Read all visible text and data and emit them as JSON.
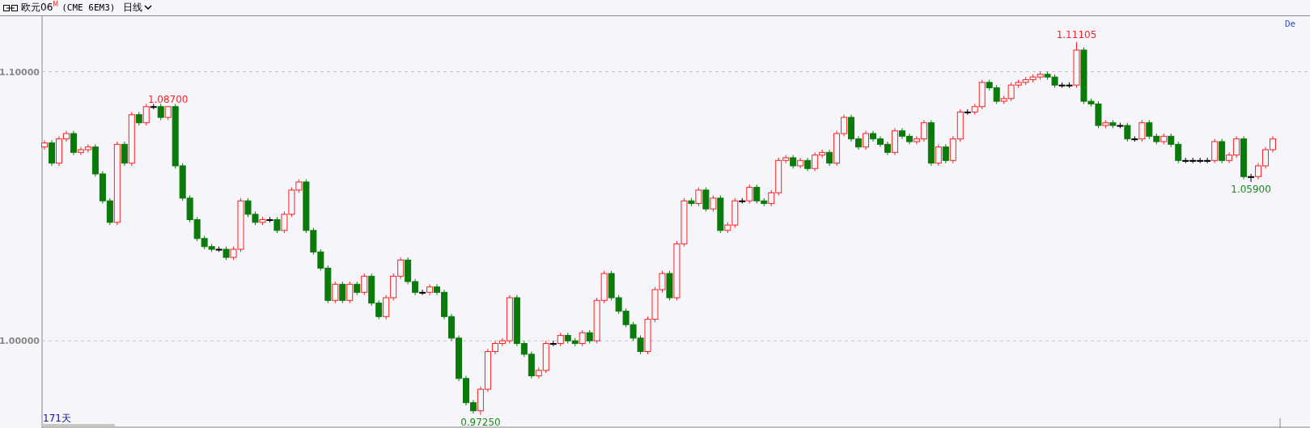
{
  "header": {
    "title": "欧元06$^{M}$",
    "contract": "(CME 6EM3)",
    "period": "日线"
  },
  "chart": {
    "corner_text": "De",
    "day_count": "171天",
    "chart_data": {
      "type": "candlestick",
      "ylim": [
        0.9676,
        1.1206
      ],
      "yticks": [
        {
          "value": 1.1,
          "label": "1.10000"
        },
        {
          "value": 1.0,
          "label": "1.00000"
        }
      ],
      "ohlc": [
        [
          1.072,
          1.0745,
          1.071,
          1.0735
        ],
        [
          1.0735,
          1.0745,
          1.065,
          1.066
        ],
        [
          1.066,
          1.076,
          1.065,
          1.075
        ],
        [
          1.075,
          1.078,
          1.074,
          1.077
        ],
        [
          1.077,
          1.078,
          1.069,
          1.07
        ],
        [
          1.07,
          1.072,
          1.069,
          1.071
        ],
        [
          1.071,
          1.073,
          1.07,
          1.072
        ],
        [
          1.072,
          1.073,
          1.061,
          1.062
        ],
        [
          1.062,
          1.063,
          1.051,
          1.052
        ],
        [
          1.052,
          1.053,
          1.043,
          1.044
        ],
        [
          1.044,
          1.074,
          1.043,
          1.073
        ],
        [
          1.073,
          1.074,
          1.065,
          1.066
        ],
        [
          1.066,
          1.085,
          1.065,
          1.084
        ],
        [
          1.084,
          1.085,
          1.08,
          1.081
        ],
        [
          1.081,
          1.088,
          1.08,
          1.087
        ],
        [
          1.087,
          1.088,
          1.086,
          1.087
        ],
        [
          1.087,
          1.088,
          1.082,
          1.083
        ],
        [
          1.083,
          1.087,
          1.082,
          1.087
        ],
        [
          1.087,
          1.088,
          1.064,
          1.065
        ],
        [
          1.065,
          1.066,
          1.052,
          1.053
        ],
        [
          1.053,
          1.054,
          1.044,
          1.045
        ],
        [
          1.045,
          1.046,
          1.037,
          1.038
        ],
        [
          1.038,
          1.039,
          1.034,
          1.035
        ],
        [
          1.035,
          1.036,
          1.033,
          1.034
        ],
        [
          1.034,
          1.035,
          1.033,
          1.034
        ],
        [
          1.034,
          1.035,
          1.03,
          1.031
        ],
        [
          1.031,
          1.035,
          1.03,
          1.034
        ],
        [
          1.034,
          1.053,
          1.033,
          1.052
        ],
        [
          1.052,
          1.053,
          1.046,
          1.047
        ],
        [
          1.047,
          1.048,
          1.043,
          1.044
        ],
        [
          1.044,
          1.046,
          1.043,
          1.045
        ],
        [
          1.045,
          1.046,
          1.044,
          1.045
        ],
        [
          1.045,
          1.046,
          1.04,
          1.041
        ],
        [
          1.041,
          1.048,
          1.04,
          1.047
        ],
        [
          1.047,
          1.057,
          1.046,
          1.056
        ],
        [
          1.056,
          1.06,
          1.055,
          1.059
        ],
        [
          1.059,
          1.06,
          1.04,
          1.041
        ],
        [
          1.041,
          1.042,
          1.032,
          1.033
        ],
        [
          1.033,
          1.034,
          1.026,
          1.027
        ],
        [
          1.027,
          1.028,
          1.014,
          1.015
        ],
        [
          1.015,
          1.022,
          1.014,
          1.021
        ],
        [
          1.021,
          1.022,
          1.014,
          1.015
        ],
        [
          1.015,
          1.022,
          1.014,
          1.021
        ],
        [
          1.021,
          1.022,
          1.017,
          1.018
        ],
        [
          1.018,
          1.025,
          1.017,
          1.024
        ],
        [
          1.024,
          1.025,
          1.013,
          1.014
        ],
        [
          1.014,
          1.015,
          1.008,
          1.009
        ],
        [
          1.009,
          1.017,
          1.008,
          1.016
        ],
        [
          1.016,
          1.025,
          1.015,
          1.024
        ],
        [
          1.024,
          1.031,
          1.023,
          1.03
        ],
        [
          1.03,
          1.031,
          1.021,
          1.022
        ],
        [
          1.022,
          1.023,
          1.017,
          1.018
        ],
        [
          1.018,
          1.019,
          1.017,
          1.018
        ],
        [
          1.018,
          1.021,
          1.017,
          1.02
        ],
        [
          1.02,
          1.021,
          1.017,
          1.018
        ],
        [
          1.018,
          1.019,
          1.008,
          1.009
        ],
        [
          1.009,
          1.01,
          1.0,
          1.001
        ],
        [
          1.001,
          1.002,
          0.985,
          0.986
        ],
        [
          0.986,
          0.987,
          0.976,
          0.977
        ],
        [
          0.977,
          0.978,
          0.973,
          0.974
        ],
        [
          0.974,
          0.983,
          0.9725,
          0.982
        ],
        [
          0.982,
          0.997,
          0.981,
          0.996
        ],
        [
          0.996,
          1.0,
          0.995,
          0.999
        ],
        [
          0.999,
          1.001,
          0.998,
          1.0
        ],
        [
          1.0,
          1.017,
          0.999,
          1.016
        ],
        [
          1.016,
          1.017,
          0.998,
          0.999
        ],
        [
          0.999,
          1.0,
          0.994,
          0.995
        ],
        [
          0.995,
          0.996,
          0.986,
          0.987
        ],
        [
          0.987,
          0.99,
          0.986,
          0.989
        ],
        [
          0.989,
          1.0,
          0.988,
          0.999
        ],
        [
          0.999,
          1.0,
          0.998,
          0.999
        ],
        [
          0.999,
          1.003,
          0.998,
          1.002
        ],
        [
          1.002,
          1.003,
          0.999,
          1.0
        ],
        [
          1.0,
          1.001,
          0.998,
          0.999
        ],
        [
          0.999,
          1.004,
          0.998,
          1.003
        ],
        [
          1.003,
          1.004,
          0.999,
          1.0
        ],
        [
          1.0,
          1.016,
          0.999,
          1.015
        ],
        [
          1.015,
          1.026,
          1.014,
          1.025
        ],
        [
          1.025,
          1.026,
          1.015,
          1.016
        ],
        [
          1.016,
          1.017,
          1.01,
          1.011
        ],
        [
          1.011,
          1.012,
          1.005,
          1.006
        ],
        [
          1.006,
          1.007,
          1.0,
          1.001
        ],
        [
          1.001,
          1.002,
          0.995,
          0.996
        ],
        [
          0.996,
          1.009,
          0.995,
          1.008
        ],
        [
          1.008,
          1.02,
          1.007,
          1.019
        ],
        [
          1.019,
          1.026,
          1.018,
          1.025
        ],
        [
          1.025,
          1.026,
          1.015,
          1.016
        ],
        [
          1.016,
          1.037,
          1.015,
          1.036
        ],
        [
          1.036,
          1.053,
          1.035,
          1.052
        ],
        [
          1.052,
          1.053,
          1.05,
          1.051
        ],
        [
          1.051,
          1.057,
          1.05,
          1.056
        ],
        [
          1.056,
          1.057,
          1.048,
          1.049
        ],
        [
          1.049,
          1.054,
          1.048,
          1.053
        ],
        [
          1.053,
          1.054,
          1.04,
          1.041
        ],
        [
          1.041,
          1.044,
          1.04,
          1.043
        ],
        [
          1.043,
          1.053,
          1.042,
          1.052
        ],
        [
          1.052,
          1.053,
          1.051,
          1.052
        ],
        [
          1.052,
          1.058,
          1.051,
          1.057
        ],
        [
          1.057,
          1.058,
          1.051,
          1.052
        ],
        [
          1.052,
          1.053,
          1.05,
          1.051
        ],
        [
          1.051,
          1.056,
          1.05,
          1.055
        ],
        [
          1.055,
          1.068,
          1.054,
          1.067
        ],
        [
          1.067,
          1.069,
          1.066,
          1.068
        ],
        [
          1.068,
          1.069,
          1.064,
          1.065
        ],
        [
          1.065,
          1.068,
          1.064,
          1.067
        ],
        [
          1.067,
          1.068,
          1.063,
          1.064
        ],
        [
          1.064,
          1.07,
          1.063,
          1.069
        ],
        [
          1.069,
          1.071,
          1.068,
          1.07
        ],
        [
          1.07,
          1.071,
          1.065,
          1.066
        ],
        [
          1.066,
          1.078,
          1.065,
          1.077
        ],
        [
          1.077,
          1.084,
          1.076,
          1.083
        ],
        [
          1.083,
          1.084,
          1.074,
          1.075
        ],
        [
          1.075,
          1.076,
          1.071,
          1.072
        ],
        [
          1.072,
          1.078,
          1.071,
          1.077
        ],
        [
          1.077,
          1.078,
          1.074,
          1.075
        ],
        [
          1.075,
          1.076,
          1.072,
          1.073
        ],
        [
          1.073,
          1.074,
          1.069,
          1.07
        ],
        [
          1.07,
          1.079,
          1.069,
          1.078
        ],
        [
          1.078,
          1.079,
          1.075,
          1.076
        ],
        [
          1.076,
          1.077,
          1.073,
          1.074
        ],
        [
          1.074,
          1.076,
          1.073,
          1.075
        ],
        [
          1.075,
          1.082,
          1.074,
          1.081
        ],
        [
          1.081,
          1.082,
          1.065,
          1.066
        ],
        [
          1.066,
          1.073,
          1.065,
          1.072
        ],
        [
          1.072,
          1.073,
          1.066,
          1.067
        ],
        [
          1.067,
          1.076,
          1.066,
          1.075
        ],
        [
          1.075,
          1.086,
          1.074,
          1.085
        ],
        [
          1.085,
          1.086,
          1.084,
          1.085
        ],
        [
          1.085,
          1.088,
          1.084,
          1.087
        ],
        [
          1.087,
          1.097,
          1.086,
          1.096
        ],
        [
          1.096,
          1.097,
          1.093,
          1.094
        ],
        [
          1.094,
          1.095,
          1.088,
          1.089
        ],
        [
          1.089,
          1.091,
          1.088,
          1.09
        ],
        [
          1.09,
          1.096,
          1.089,
          1.095
        ],
        [
          1.095,
          1.097,
          1.094,
          1.096
        ],
        [
          1.096,
          1.098,
          1.095,
          1.097
        ],
        [
          1.097,
          1.099,
          1.096,
          1.098
        ],
        [
          1.098,
          1.1,
          1.097,
          1.099
        ],
        [
          1.099,
          1.1,
          1.097,
          1.098
        ],
        [
          1.098,
          1.099,
          1.094,
          1.095
        ],
        [
          1.095,
          1.096,
          1.094,
          1.095
        ],
        [
          1.095,
          1.096,
          1.094,
          1.095
        ],
        [
          1.095,
          1.11105,
          1.094,
          1.108
        ],
        [
          1.108,
          1.109,
          1.088,
          1.089
        ],
        [
          1.089,
          1.09,
          1.087,
          1.088
        ],
        [
          1.088,
          1.089,
          1.079,
          1.08
        ],
        [
          1.08,
          1.082,
          1.079,
          1.081
        ],
        [
          1.081,
          1.082,
          1.079,
          1.08
        ],
        [
          1.08,
          1.081,
          1.079,
          1.08
        ],
        [
          1.08,
          1.081,
          1.074,
          1.075
        ],
        [
          1.075,
          1.076,
          1.074,
          1.075
        ],
        [
          1.075,
          1.082,
          1.074,
          1.081
        ],
        [
          1.081,
          1.082,
          1.075,
          1.076
        ],
        [
          1.076,
          1.077,
          1.073,
          1.074
        ],
        [
          1.074,
          1.077,
          1.073,
          1.076
        ],
        [
          1.076,
          1.077,
          1.072,
          1.073
        ],
        [
          1.073,
          1.074,
          1.066,
          1.067
        ],
        [
          1.067,
          1.068,
          1.066,
          1.067
        ],
        [
          1.067,
          1.068,
          1.066,
          1.067
        ],
        [
          1.067,
          1.068,
          1.066,
          1.067
        ],
        [
          1.067,
          1.068,
          1.066,
          1.067
        ],
        [
          1.067,
          1.075,
          1.066,
          1.074
        ],
        [
          1.074,
          1.075,
          1.066,
          1.067
        ],
        [
          1.067,
          1.07,
          1.066,
          1.069
        ],
        [
          1.069,
          1.076,
          1.068,
          1.075
        ],
        [
          1.075,
          1.076,
          1.06,
          1.061
        ],
        [
          1.061,
          1.062,
          1.059,
          1.061
        ],
        [
          1.061,
          1.066,
          1.06,
          1.065
        ],
        [
          1.065,
          1.072,
          1.064,
          1.071
        ],
        [
          1.071,
          1.076,
          1.07,
          1.075
        ]
      ],
      "categories": [
        null,
        null,
        null,
        null,
        null,
        null,
        null,
        null,
        null,
        null,
        null,
        null,
        null,
        null,
        null,
        null,
        null,
        null,
        null,
        null,
        null,
        null,
        null,
        null,
        null,
        null,
        null,
        null,
        null,
        null,
        null,
        null,
        null,
        null,
        null,
        null,
        null,
        null,
        null,
        null,
        null,
        null,
        null,
        null,
        null,
        null,
        null,
        null,
        null,
        null,
        null,
        null,
        null,
        null,
        null,
        null,
        null,
        null,
        null,
        null,
        null,
        null,
        null,
        null,
        null,
        null,
        null,
        null,
        null,
        null,
        null,
        null,
        null,
        null,
        null,
        null,
        null,
        null,
        null,
        null,
        null,
        null,
        null,
        null,
        null,
        null,
        null,
        null,
        null,
        null,
        null,
        null,
        null,
        null,
        null,
        null,
        null,
        null,
        null,
        null,
        null,
        null,
        null,
        null,
        null,
        null,
        null,
        null,
        null,
        null,
        null,
        null,
        null,
        null,
        null,
        null,
        null,
        null,
        null,
        null,
        null,
        null,
        null,
        null,
        null,
        null,
        null,
        null,
        null,
        null,
        null,
        null,
        null,
        null,
        null,
        null,
        null,
        null,
        null,
        null,
        null,
        null,
        null,
        null,
        null,
        null,
        null,
        null,
        null,
        null,
        null,
        null,
        null,
        null,
        null,
        null,
        null,
        null,
        null,
        null,
        null,
        null,
        null,
        null,
        null,
        null,
        null,
        null,
        null,
        null
      ],
      "annotations": [
        "1.08700",
        "0.97250",
        "1.11105",
        "1.05900"
      ]
    }
  }
}
